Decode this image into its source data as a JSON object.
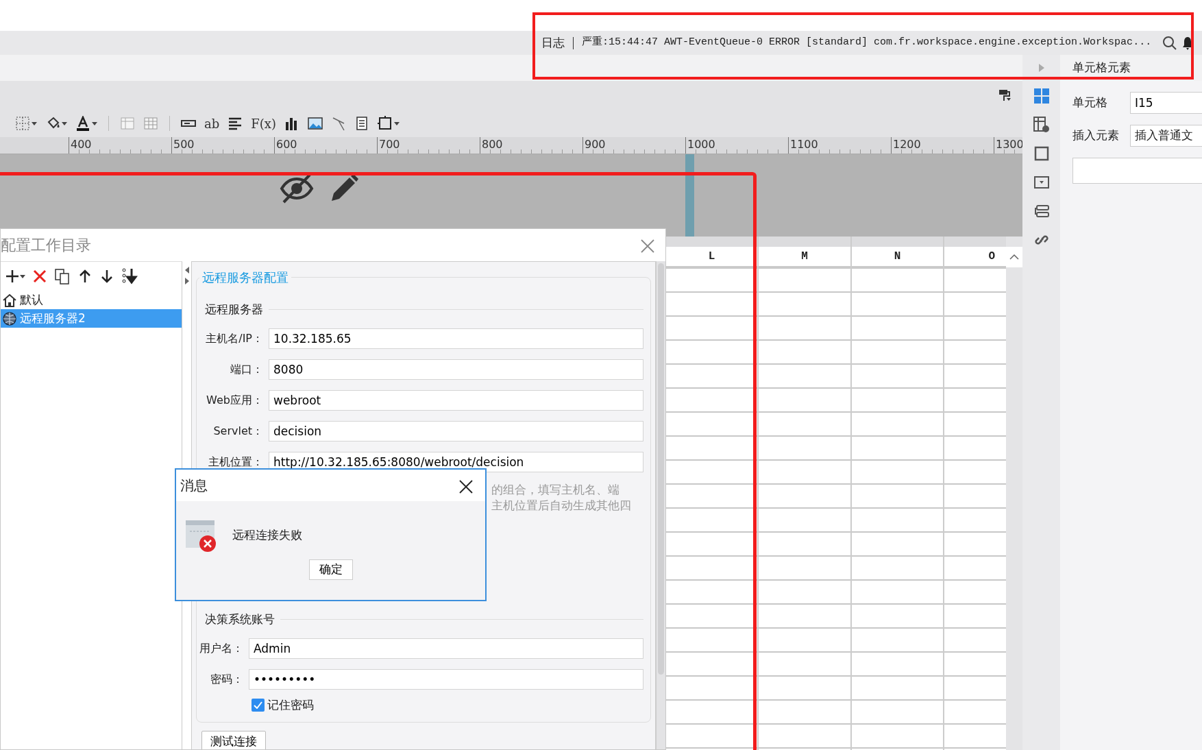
{
  "log_bar": {
    "label": "日志",
    "message": "严重:15:44:47 AWT-EventQueue-0 ERROR [standard] com.fr.workspace.engine.exception.Workspac..."
  },
  "toolbar": [
    {
      "kind": "borders"
    },
    {
      "kind": "fill"
    },
    {
      "kind": "font-color"
    },
    {
      "kind": "sep"
    },
    {
      "kind": "table"
    },
    {
      "kind": "table-grid"
    },
    {
      "kind": "sep"
    },
    {
      "kind": "textbox"
    },
    {
      "kind": "text",
      "label": "ab"
    },
    {
      "kind": "align"
    },
    {
      "kind": "text",
      "label": "F(x)"
    },
    {
      "kind": "chart"
    },
    {
      "kind": "image"
    },
    {
      "kind": "slash"
    },
    {
      "kind": "doc"
    },
    {
      "kind": "frame"
    }
  ],
  "ruler": [
    "400",
    "500",
    "600",
    "700",
    "800",
    "900",
    "1000",
    "1100",
    "1200",
    "1300"
  ],
  "grid": {
    "columns": [
      "L",
      "M",
      "N",
      "O"
    ]
  },
  "right_panel": {
    "title": "单元格元素",
    "cell_label": "单元格",
    "cell_value": "I15",
    "insert_label": "插入元素",
    "insert_value": "插入普通文"
  },
  "workdir_dialog": {
    "title": "配置工作目录",
    "tree": [
      {
        "label": "默认",
        "kind": "home",
        "selected": false
      },
      {
        "label": "远程服务器2",
        "kind": "globe",
        "selected": true
      }
    ],
    "legend": "远程服务器配置",
    "server_section": "远程服务器",
    "server_fields": [
      {
        "label": "主机名/IP：",
        "value": "10.32.185.65"
      },
      {
        "label": "端口：",
        "value": "8080"
      },
      {
        "label": "Web应用：",
        "value": "webroot"
      },
      {
        "label": "Servlet：",
        "value": "decision"
      },
      {
        "label": "主机位置：",
        "value": "http://10.32.185.65:8080/webroot/decision"
      }
    ],
    "hint_lines": [
      "的组合，填写主机名、端",
      "主机位置后自动生成其他四"
    ],
    "account_section": "决策系统账号",
    "account_fields": [
      {
        "label": "用户名：",
        "value": "Admin"
      },
      {
        "label": "密码：",
        "value": "•••••••••"
      }
    ],
    "remember": {
      "label": "记住密码",
      "checked": true
    },
    "test_button": "测试连接"
  },
  "message_dialog": {
    "title": "消息",
    "text": "远程连接失败",
    "ok": "确定"
  }
}
